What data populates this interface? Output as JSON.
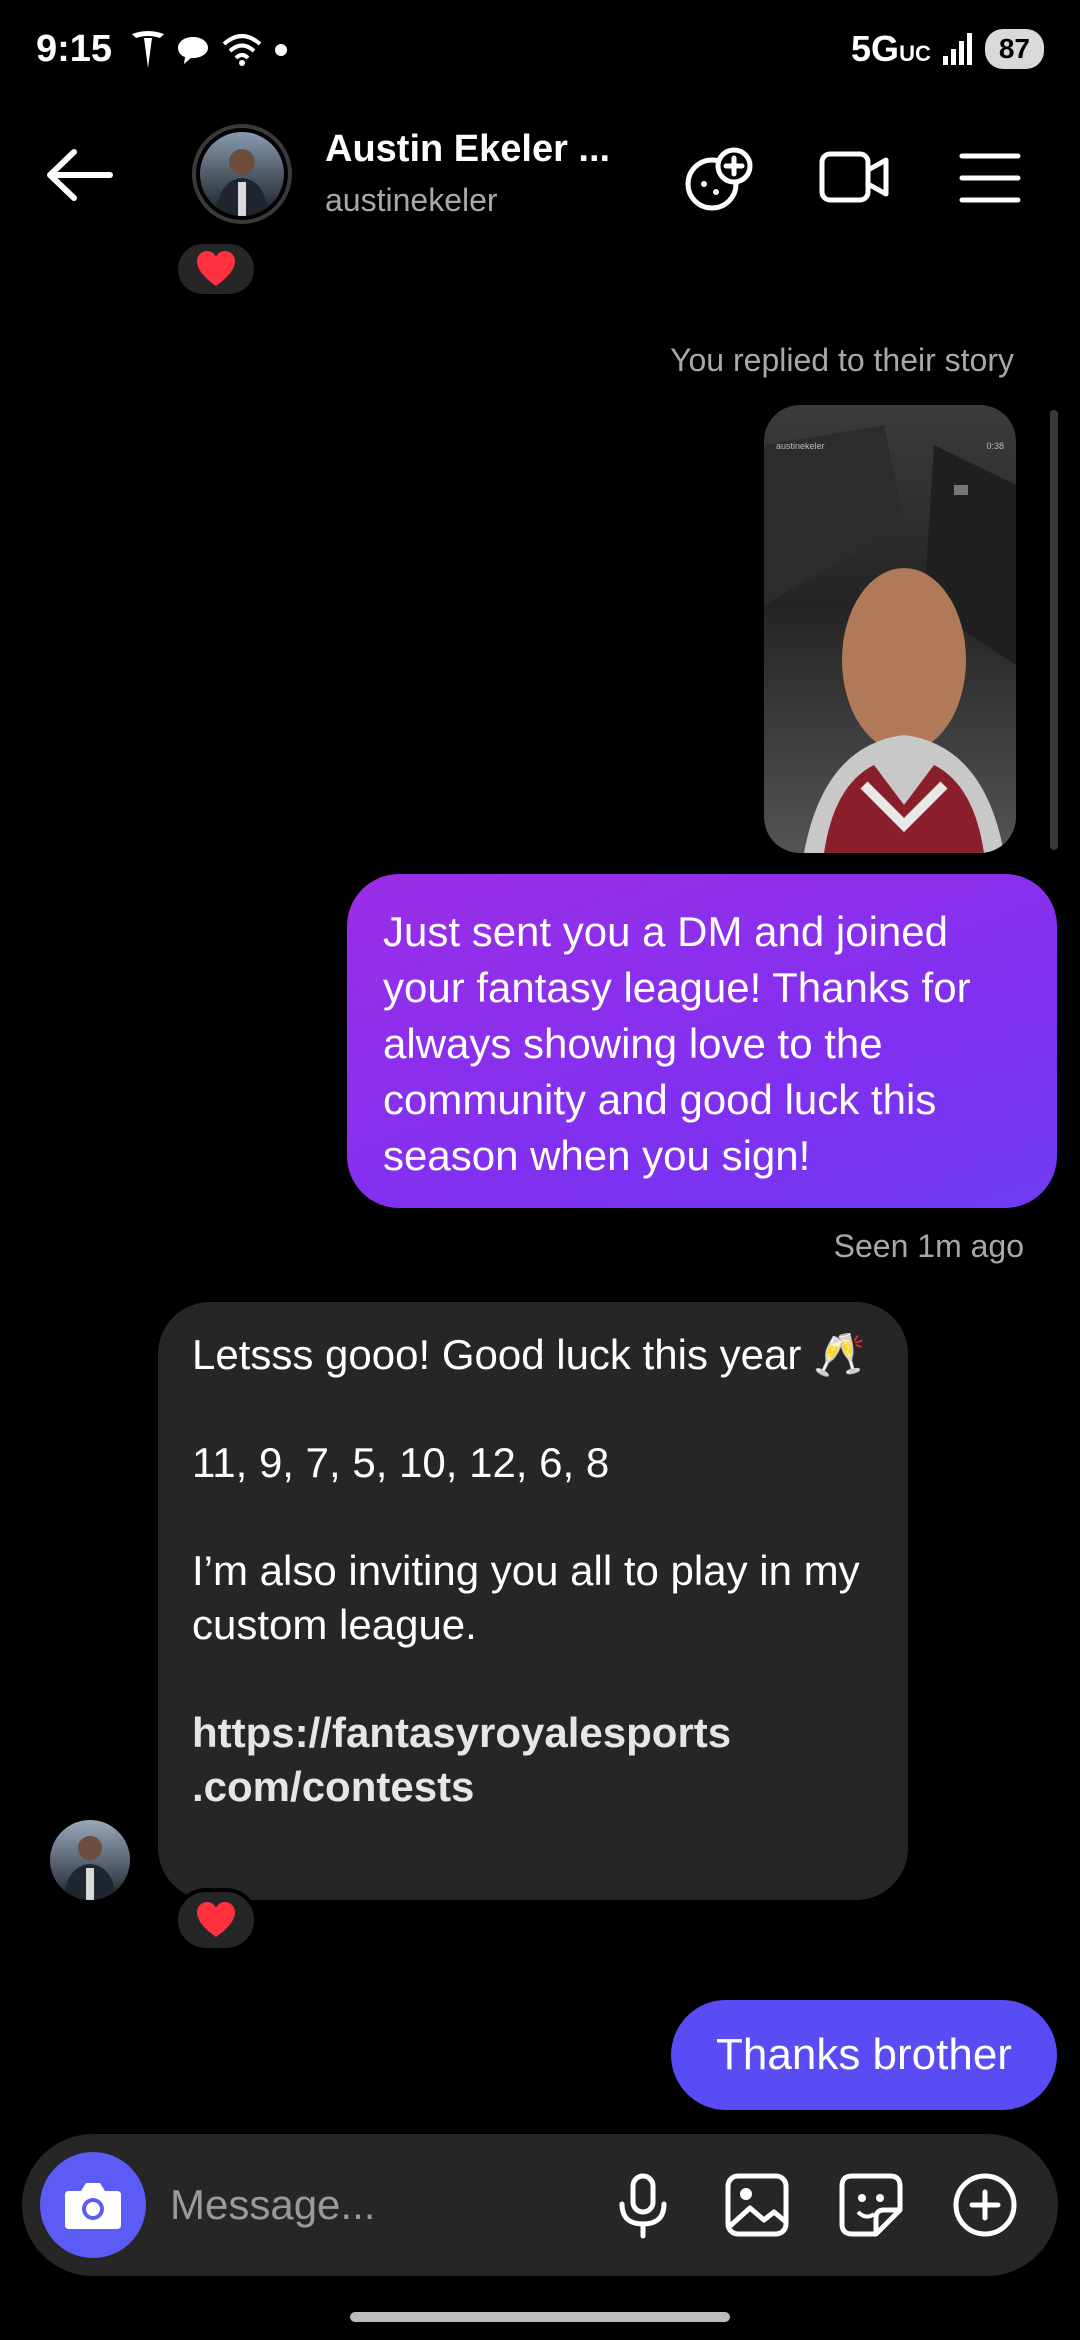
{
  "status_bar": {
    "time": "9:15",
    "network": "5G",
    "network_sub": "UC",
    "battery": "87"
  },
  "header": {
    "name": "Austin Ekeler ...",
    "handle": "austinekeler"
  },
  "reactions": {
    "emoji": "❤️",
    "top_reaction_color": "#ff3040"
  },
  "messages": {
    "story_label": "You replied to their story",
    "story_thumb_user": "austinekeler",
    "story_thumb_time": "0:38",
    "sent_1": "Just sent you a DM and joined your fantasy league! Thanks for always showing love to the community and good luck this season when you sign!",
    "seen": "Seen 1m ago",
    "received": {
      "line_1": "Letsss gooo! Good luck this year 🥂",
      "line_2": "11, 9, 7, 5, 10, 12, 6, 8",
      "line_3": "I’m also inviting you all to play in my custom league.",
      "link": "https://fantasyroyalesports .com/contests"
    },
    "sent_2": "Thanks brother"
  },
  "composer": {
    "placeholder": "Message..."
  },
  "colors": {
    "sent_gradient_start": "#9b2ee6",
    "sent_gradient_end": "#6f3bf3",
    "sent_2": "#5a4cf5",
    "received": "#262626",
    "camera_button": "#5b5cf6"
  }
}
